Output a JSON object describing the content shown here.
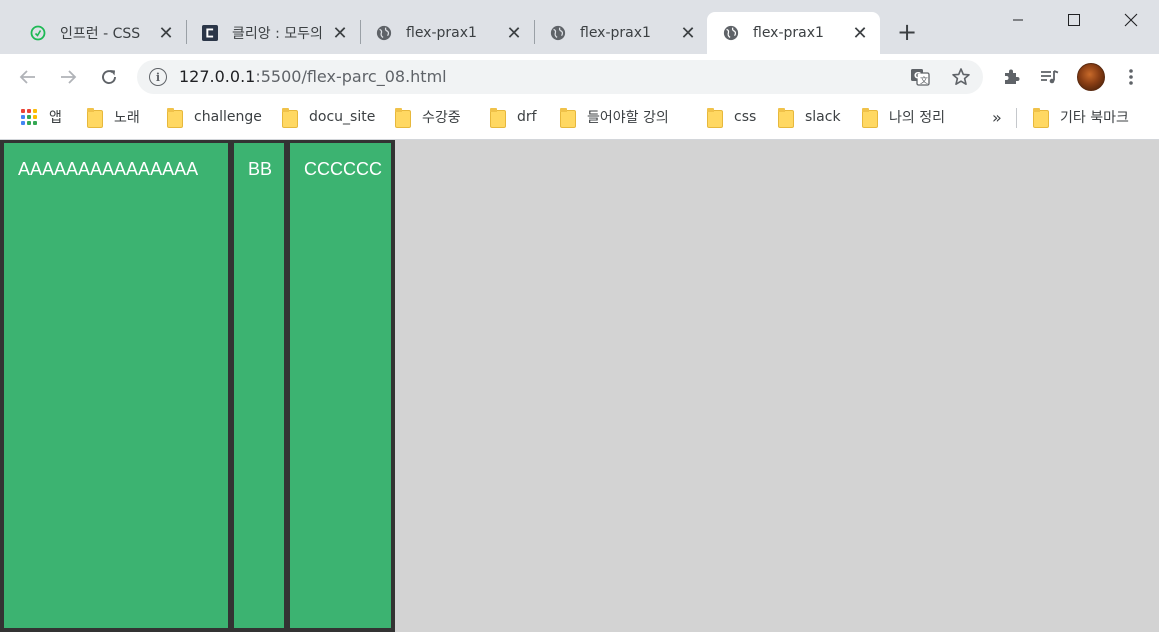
{
  "tabs": [
    {
      "title": "인프런 - CSS",
      "favicon": "inflearn-icon",
      "active": false
    },
    {
      "title": "클리앙 : 모두의",
      "favicon": "clien-icon",
      "active": false
    },
    {
      "title": "flex-prax1",
      "favicon": "globe-icon",
      "active": false
    },
    {
      "title": "flex-prax1",
      "favicon": "globe-icon",
      "active": false
    },
    {
      "title": "flex-prax1",
      "favicon": "globe-icon",
      "active": true
    }
  ],
  "address_bar": {
    "host": "127.0.0.1",
    "path": ":5500/flex-parc_08.html"
  },
  "bookmarks": {
    "apps_label": "앱",
    "items": [
      "노래",
      "challenge",
      "docu_site",
      "수강중",
      "drf",
      "들어야할 강의",
      "css",
      "slack",
      "나의 정리"
    ],
    "overflow_label": "»",
    "other_label": "기타 북마크"
  },
  "page": {
    "items": [
      "AAAAAAAAAAAAAAA",
      "BB",
      "CCCCCC"
    ],
    "item_color": "#3cb371",
    "border_color": "#333333",
    "background_color": "#d3d3d3"
  }
}
